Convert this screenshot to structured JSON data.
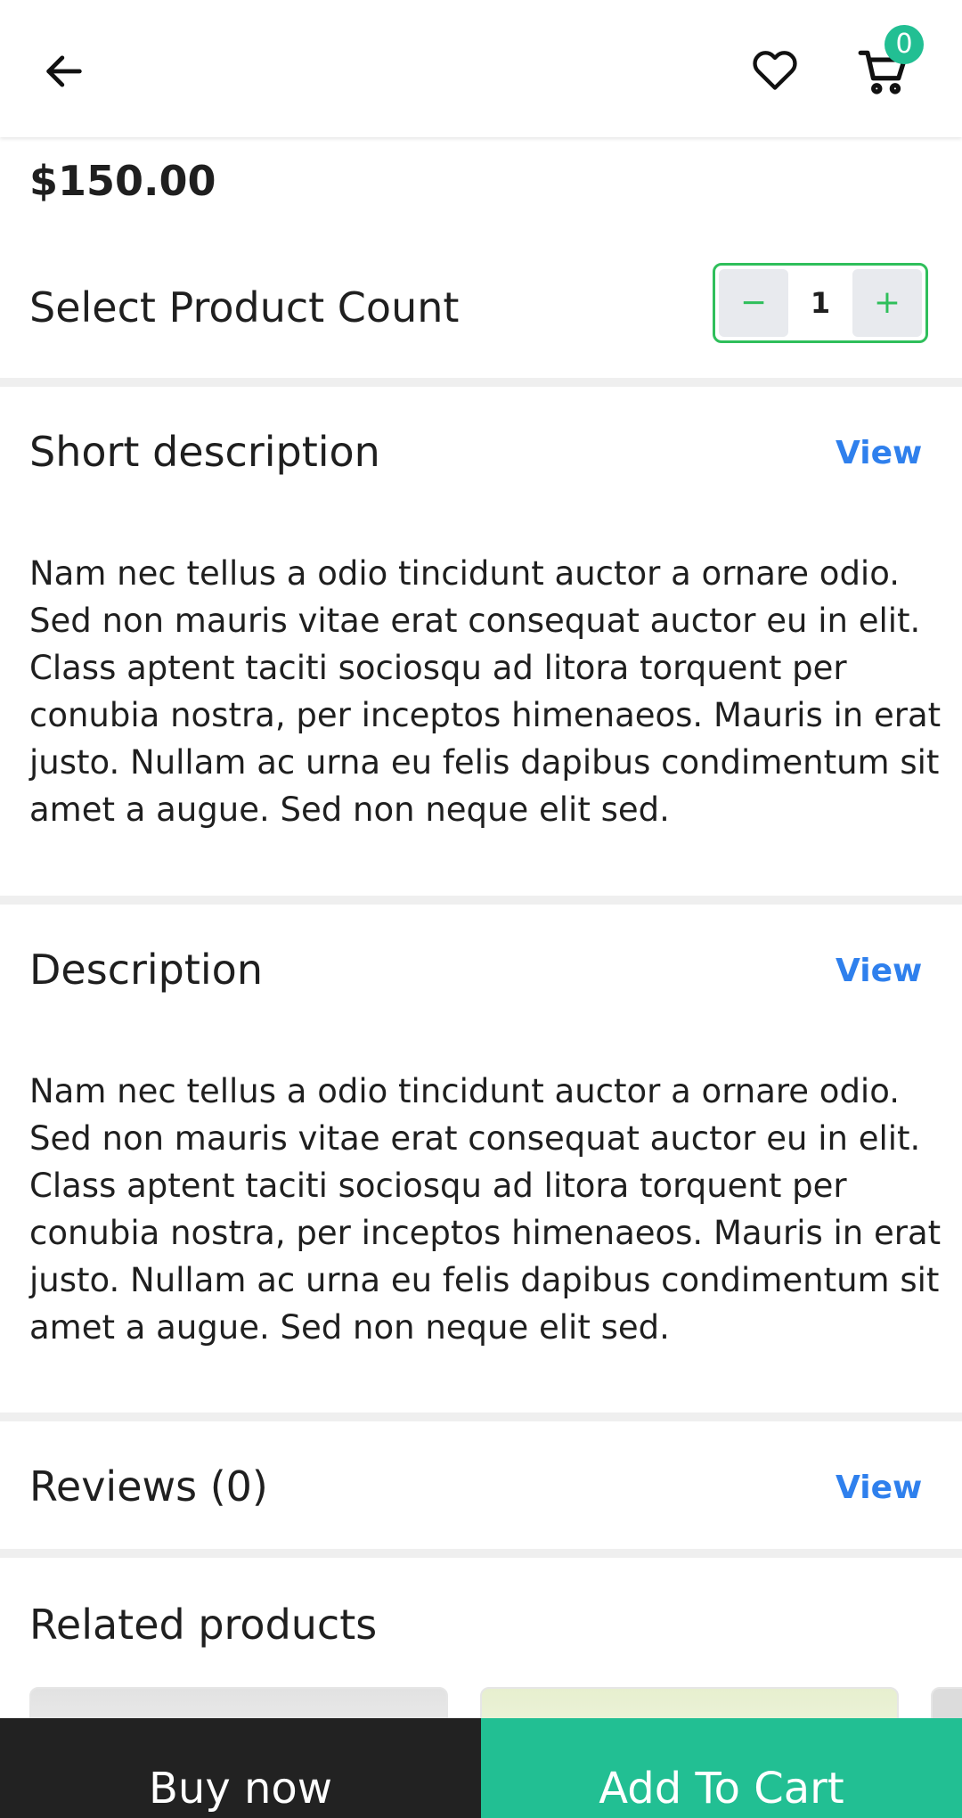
{
  "header": {
    "back_icon": "arrow-left-icon",
    "wishlist_icon": "heart-icon",
    "cart_icon": "cart-icon",
    "cart_badge": "0",
    "badge_color": "#22bf93"
  },
  "product": {
    "price": "$150.00",
    "count_label": "Select Product Count",
    "quantity": "1",
    "stepper_minus": "−",
    "stepper_plus": "+"
  },
  "sections": {
    "short_description": {
      "title": "Short description",
      "view_label": "View",
      "text": "Nam nec tellus a odio tincidunt auctor a ornare odio. Sed non mauris vitae erat consequat auctor eu in elit. Class aptent taciti sociosqu ad litora torquent per conubia nostra, per inceptos himenaeos. Mauris in erat justo. Nullam ac urna eu felis dapibus condimentum sit amet a augue. Sed non neque elit sed."
    },
    "description": {
      "title": "Description",
      "view_label": "View",
      "text": "Nam nec tellus a odio tincidunt auctor a ornare odio. Sed non mauris vitae erat consequat auctor eu in elit. Class aptent taciti sociosqu ad litora torquent per conubia nostra, per inceptos himenaeos. Mauris in erat justo. Nullam ac urna eu felis dapibus condimentum sit amet a augue. Sed non neque elit sed."
    },
    "reviews": {
      "title": "Reviews (0)",
      "view_label": "View"
    },
    "related": {
      "title": "Related products"
    }
  },
  "actions": {
    "buy_now": "Buy now",
    "add_to_cart": "Add To Cart",
    "buy_color": "#222222",
    "add_color": "#22bf93"
  }
}
